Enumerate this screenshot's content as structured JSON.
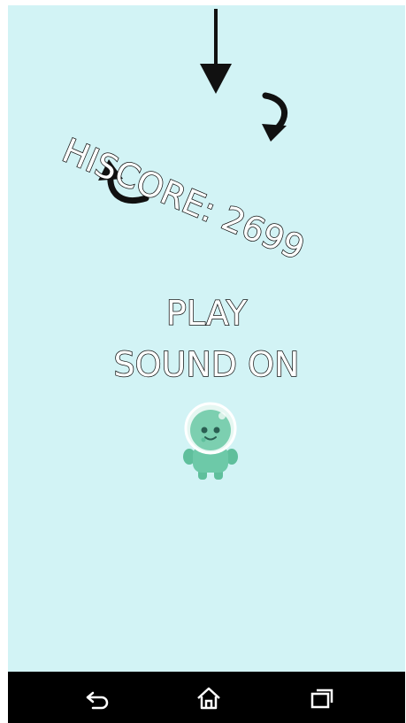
{
  "game": {
    "hiscore_text": "HISCORE: 2699",
    "play_label": "PLAY",
    "sound_label": "SOUND ON"
  },
  "colors": {
    "background": "#d2f3f5",
    "character": "#6dc9a8",
    "navbar": "#000000"
  },
  "navbar": {
    "buttons": [
      "back-icon",
      "home-icon",
      "recent-apps-icon"
    ]
  }
}
